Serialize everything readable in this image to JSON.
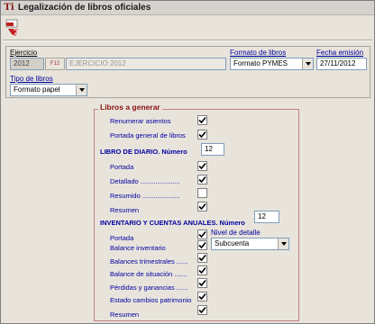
{
  "window": {
    "title": "Legalización de libros oficiales"
  },
  "header": {
    "ejercicio_label": "Ejercicio",
    "ejercicio_value": "2012",
    "f12_label": "F12",
    "ejercicio_desc": "EJERCICIO 2012",
    "formato_label": "Formato de libros",
    "formato_value": "Formato PYMES",
    "fecha_label": "Fecha emisión",
    "fecha_value": "27/11/2012",
    "tipo_label": "Tipo de libros",
    "tipo_value": "Formato papel"
  },
  "libros": {
    "title": "Libros a generar",
    "renumerar": {
      "label": "Renumerar asientos",
      "checked": true
    },
    "portada_general": {
      "label": "Portada general de libros",
      "checked": true
    },
    "diario": {
      "heading": "LIBRO DE DIARIO.",
      "numero_label": "Número",
      "numero_value": "12",
      "portada": {
        "label": "Portada",
        "checked": true
      },
      "detallado": {
        "label": "Detallado .....................",
        "checked": true
      },
      "resumido": {
        "label": "Resumido ....................",
        "checked": false
      },
      "resumen": {
        "label": "Resumen",
        "checked": true
      }
    },
    "inventario": {
      "heading": "INVENTARIO Y CUENTAS ANUALES.",
      "numero_label": "Número",
      "numero_value": "12",
      "portada": {
        "label": "Portada",
        "checked": true
      },
      "balance_inventario": {
        "label": "Balance inventario",
        "checked": true
      },
      "balances_trimestrales": {
        "label": "Balances trimestrales ......",
        "checked": true
      },
      "balance_situacion": {
        "label": "Balance de situación .......",
        "checked": true
      },
      "perdidas_ganancias": {
        "label": "Pérdidas y ganancias ......",
        "checked": true
      },
      "estado_cambios": {
        "label": "Estado cambios patrimonio",
        "checked": true
      },
      "resumen": {
        "label": "Resumen",
        "checked": true
      },
      "nivel_label": "Nivel de detalle",
      "nivel_value": "Subcuenta"
    }
  },
  "colors": {
    "accent": "#8a1010",
    "label_blue": "#0000a0",
    "window_bg": "#e8e4dc"
  }
}
